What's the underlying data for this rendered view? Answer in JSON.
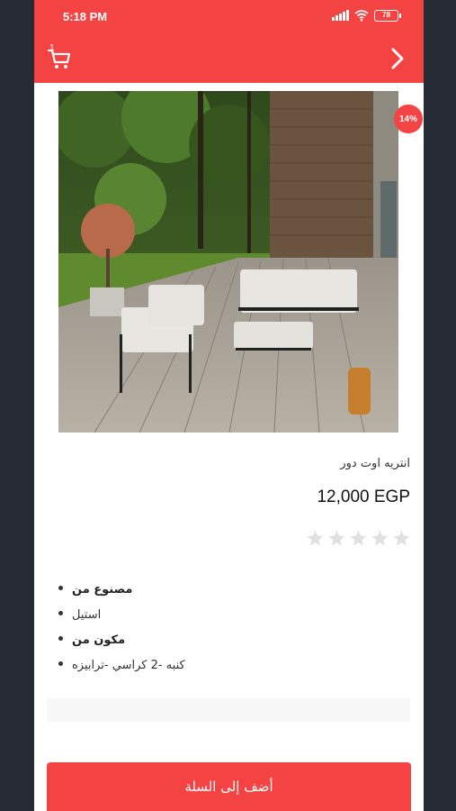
{
  "status_bar": {
    "time": "5:18 PM",
    "battery": "78"
  },
  "header": {
    "cart_count": "1"
  },
  "product": {
    "discount_badge": "14%",
    "name": "انتريه اوت دور",
    "price": "12,000 EGP",
    "rating": 0,
    "rating_max": 5,
    "details": [
      {
        "text": "مصنوع من",
        "bold": true
      },
      {
        "text": "استيل",
        "bold": false
      },
      {
        "text": "مكون من",
        "bold": true
      },
      {
        "text": "كنبه -2 كراسي -ترابيزه",
        "bold": false
      }
    ]
  },
  "actions": {
    "add_to_cart": "أضف إلى السلة"
  },
  "colors": {
    "accent": "#f44343",
    "background": "#262b36",
    "star_empty": "#e0e0e0"
  },
  "icons": [
    "cart-icon",
    "chevron-right-icon",
    "star-icon",
    "wifi-icon",
    "signal-icon",
    "battery-icon"
  ]
}
